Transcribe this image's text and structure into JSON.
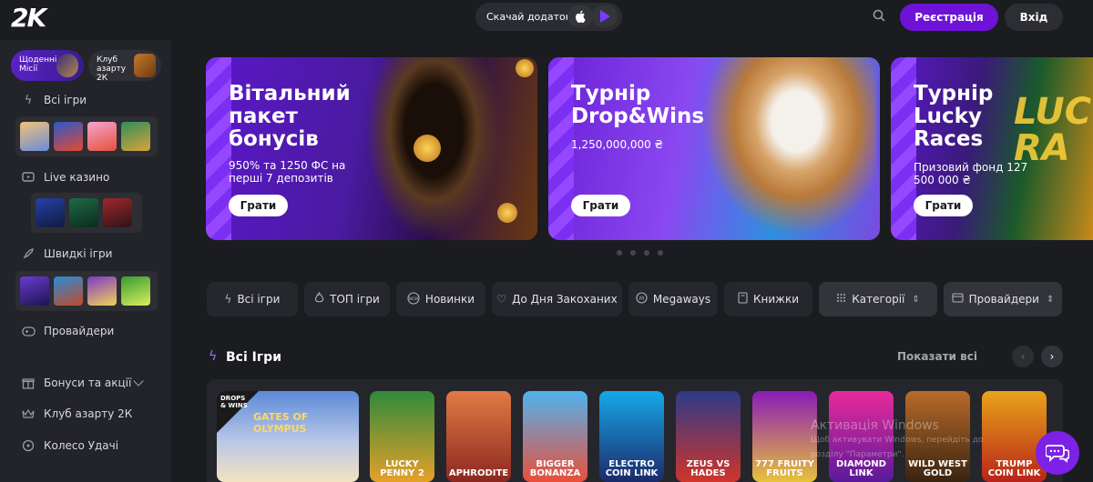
{
  "header": {
    "logo": "2K",
    "download_label": "Скачай додаток!",
    "register_label": "Реєстрація",
    "login_label": "Вхід"
  },
  "sidebar": {
    "tab_daily": "Щоденні Місії",
    "tab_club": "Клуб азарту 2К",
    "items": [
      {
        "label": "Всі ігри",
        "icon": "bolt-icon"
      },
      {
        "label": "Live казино",
        "icon": "tv-icon"
      },
      {
        "label": "Швидкі ігри",
        "icon": "rocket-icon"
      },
      {
        "label": "Провайдери",
        "icon": "gamepad-icon"
      },
      {
        "label": "Бонуси та акції",
        "icon": "gift-icon"
      },
      {
        "label": "Клуб азарту 2К",
        "icon": "crown-icon"
      },
      {
        "label": "Колесо Удачі",
        "icon": "wheel-icon"
      }
    ]
  },
  "banners": [
    {
      "title": "Вітальний пакет бонусів",
      "sub": "950% та 1250 ФС на перші 7 депозитів",
      "button": "Грати"
    },
    {
      "title": "Турнір Drop&Wins",
      "sub": "1,250,000,000 ₴",
      "button": "Грати"
    },
    {
      "title": "Турнір Lucky Races",
      "sub": "Призовий фонд 127 500 000 ₴",
      "button": "Грати"
    }
  ],
  "filters": [
    {
      "label": "Всі ігри",
      "icon": "bolt-icon"
    },
    {
      "label": "ТОП ігри",
      "icon": "flame-icon"
    },
    {
      "label": "Новинки",
      "icon": "new-icon"
    },
    {
      "label": "До Дня Закоханих",
      "icon": "heart-icon"
    },
    {
      "label": "Megaways",
      "icon": "megaways-icon"
    },
    {
      "label": "Книжки",
      "icon": "book-icon"
    },
    {
      "label": "Категорії",
      "icon": "grid-icon"
    },
    {
      "label": "Провайдери",
      "icon": "provider-icon"
    }
  ],
  "section": {
    "title": "Всі Ігри",
    "show_all": "Показати всі"
  },
  "games": [
    {
      "title": "GATES OF OLYMPUS",
      "badge": "DROPS & WINS"
    },
    {
      "title": "LUCKY PENNY 2"
    },
    {
      "title": "APHRODITE"
    },
    {
      "title": "BIGGER BONANZA"
    },
    {
      "title": "ELECTRO COIN LINK"
    },
    {
      "title": "ZEUS VS HADES"
    },
    {
      "title": "777 FRUITY FRUITS"
    },
    {
      "title": "DIAMOND LINK"
    },
    {
      "title": "WILD WEST GOLD"
    },
    {
      "title": "TRUMP COIN LINK"
    }
  ],
  "watermark": {
    "line1": "Активація Windows",
    "line2": "Щоб активувати Windows, перейдіть до розділу \"Параметри\"."
  },
  "colors": {
    "accent": "#6e12d8",
    "background": "#1b1c1f",
    "sidebar": "#23242a"
  }
}
